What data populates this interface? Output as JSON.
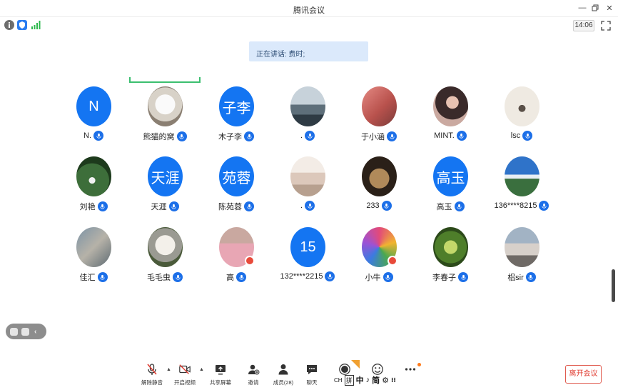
{
  "window": {
    "title": "腾讯会议"
  },
  "status": {
    "time": "14:06"
  },
  "banner": {
    "speaking": "正在讲话: 费时;"
  },
  "participants": [
    {
      "name": "N.",
      "avatar_text": "N",
      "type": "letter"
    },
    {
      "name": "熊猫的窝",
      "avatar_text": "",
      "type": "photo",
      "photo": "white-puppy"
    },
    {
      "name": "木子李",
      "avatar_text": "子李",
      "type": "letter"
    },
    {
      "name": ".",
      "avatar_text": "",
      "type": "photo",
      "photo": "lake-landscape"
    },
    {
      "name": "于小涵",
      "avatar_text": "",
      "type": "photo",
      "photo": "pink-room"
    },
    {
      "name": "MINT.",
      "avatar_text": "",
      "type": "photo",
      "photo": "girl-with-dog"
    },
    {
      "name": "lsc",
      "avatar_text": "",
      "type": "photo",
      "photo": "ink-bird"
    },
    {
      "name": "刘艳",
      "avatar_text": "",
      "type": "photo",
      "photo": "lily-of-the-valley"
    },
    {
      "name": "天涯",
      "avatar_text": "天涯",
      "type": "letter"
    },
    {
      "name": "陈苑蓉",
      "avatar_text": "苑蓉",
      "type": "letter"
    },
    {
      "name": ".",
      "avatar_text": "",
      "type": "photo",
      "photo": "girl-illustration"
    },
    {
      "name": "233",
      "avatar_text": "",
      "type": "photo",
      "photo": "brown-bear"
    },
    {
      "name": "高玉",
      "avatar_text": "高玉",
      "type": "letter"
    },
    {
      "name": "136****8215",
      "avatar_text": "",
      "type": "photo",
      "photo": "blue-sky-lake"
    },
    {
      "name": "佳汇",
      "avatar_text": "",
      "type": "photo",
      "photo": "blurred-street"
    },
    {
      "name": "毛毛虫",
      "avatar_text": "",
      "type": "photo",
      "photo": "dog-headphones"
    },
    {
      "name": "高",
      "avatar_text": "",
      "type": "photo",
      "photo": "pink-toy"
    },
    {
      "name": "132****2215",
      "avatar_text": "15",
      "type": "letter"
    },
    {
      "name": "小牛",
      "avatar_text": "",
      "type": "photo",
      "photo": "colorful-flower"
    },
    {
      "name": "李春子",
      "avatar_text": "",
      "type": "photo",
      "photo": "green-plant"
    },
    {
      "name": "梠sir",
      "avatar_text": "",
      "type": "photo",
      "photo": "couple-holding-hands"
    }
  ],
  "toolbar": {
    "unmute": "解除静音",
    "start_video": "开启视频",
    "share_screen": "共享屏幕",
    "invite": "邀请",
    "members": "成员(28)",
    "chat": "聊天",
    "ime": [
      "CH",
      "拼",
      "中",
      "♪",
      "简"
    ],
    "leave": "离开会议"
  },
  "colors": {
    "accent": "#1475f2",
    "leave": "#e03c31",
    "banner": "#dbe9fb"
  }
}
